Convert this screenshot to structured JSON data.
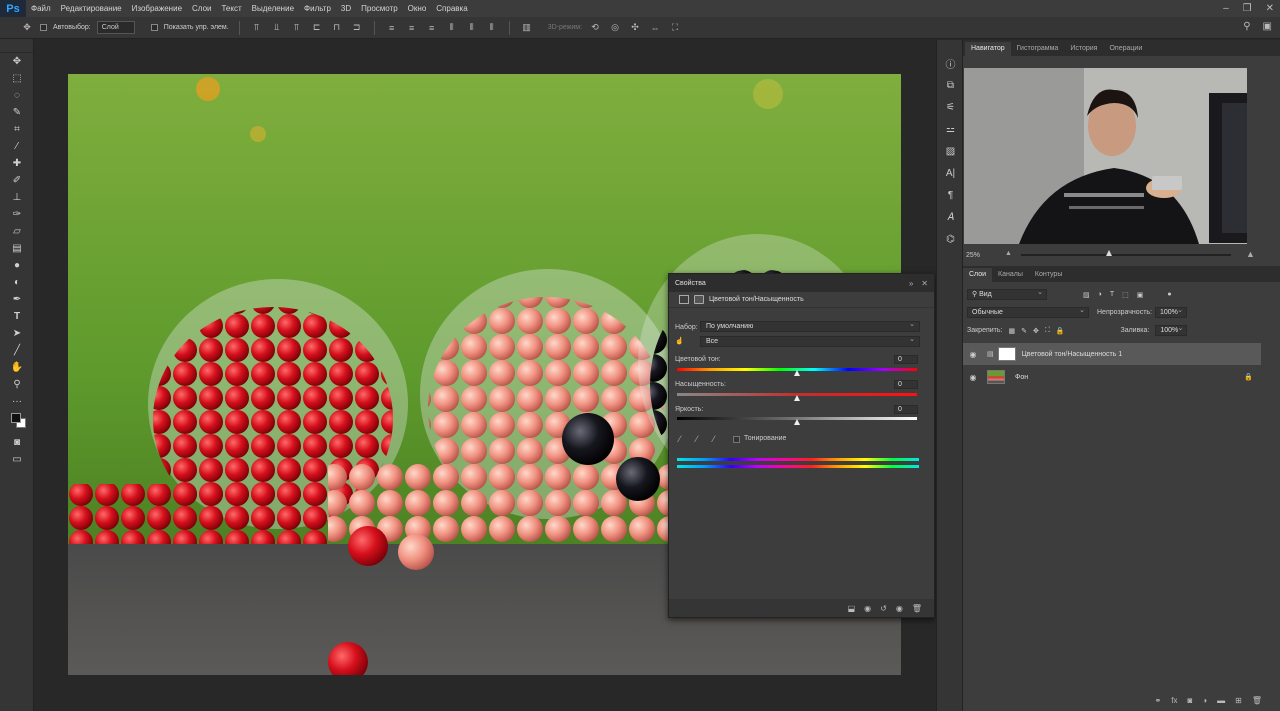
{
  "app": {
    "logo": "Ps"
  },
  "menu": [
    "Файл",
    "Редактирование",
    "Изображение",
    "Слои",
    "Текст",
    "Выделение",
    "Фильтр",
    "3D",
    "Просмотр",
    "Окно",
    "Справка"
  ],
  "window_controls": [
    "–",
    "❐",
    "✕"
  ],
  "options_bar": {
    "auto_select_label": "Автовыбор:",
    "auto_select_value": "Слой",
    "show_transform_label": "Показать упр. элем.",
    "mode_3d_label": "3D-режим:"
  },
  "tools": [
    "move-icon",
    "marquee-icon",
    "lasso-icon",
    "quick-select-icon",
    "crop-icon",
    "eyedropper-icon",
    "healing-icon",
    "brush-icon",
    "stamp-icon",
    "history-brush-icon",
    "eraser-icon",
    "gradient-icon",
    "blur-icon",
    "dodge-icon",
    "pen-icon",
    "type-icon",
    "path-select-icon",
    "line-icon",
    "hand-icon",
    "zoom-icon",
    "more-icon"
  ],
  "properties": {
    "tab": "Свойства",
    "title": "Цветовой тон/Насыщенность",
    "preset_label": "Набор:",
    "preset_value": "По умолчанию",
    "channel_value": "Все",
    "hue_label": "Цветовой тон:",
    "hue_value": "0",
    "saturation_label": "Насыщенность:",
    "saturation_value": "0",
    "lightness_label": "Яркость:",
    "lightness_value": "0",
    "colorize_label": "Тонирование",
    "hue_level": 0.5,
    "saturation_level": 0.5,
    "lightness_level": 0.5
  },
  "navigator": {
    "tabs": [
      "Навигатор",
      "Гистограмма",
      "История",
      "Операции"
    ],
    "zoom": "25%"
  },
  "layers_panel": {
    "tabs": [
      "Слои",
      "Каналы",
      "Контуры"
    ],
    "kind_filter": "Вид",
    "blend_mode": "Обычные",
    "opacity_label": "Непрозрачность:",
    "opacity_value": "100%",
    "lock_label": "Закрепить:",
    "fill_label": "Заливка:",
    "fill_value": "100%",
    "layers": [
      {
        "name": "Цветовой тон/Насыщенность 1",
        "selected": true
      },
      {
        "name": "Фон",
        "selected": false
      }
    ]
  },
  "colors": {
    "accent": "#31a8ff",
    "panel": "#3d3d3d",
    "background": "#282828"
  }
}
